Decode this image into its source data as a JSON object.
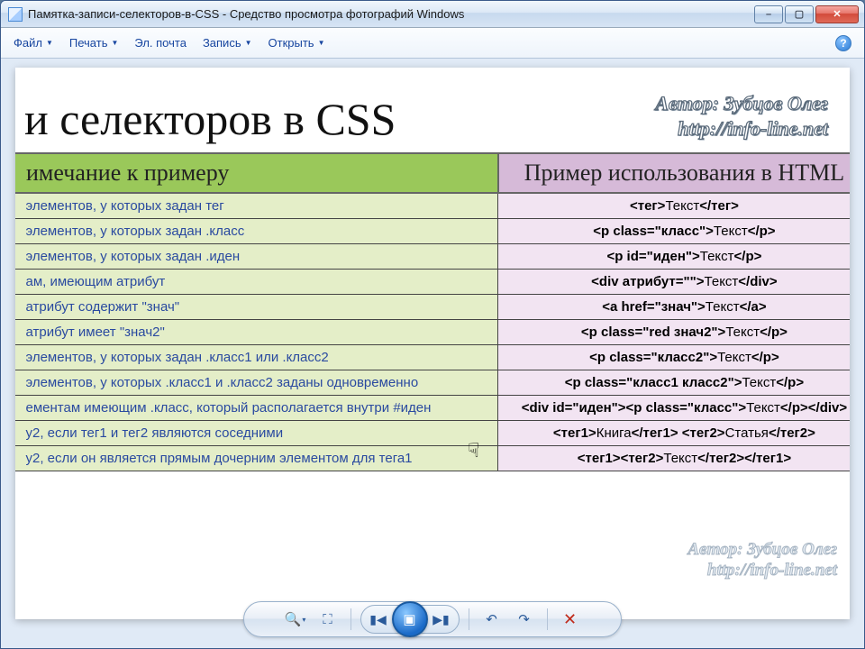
{
  "window": {
    "title": "Памятка-записи-селекторов-в-CSS - Средство просмотра фотографий Windows"
  },
  "menu": {
    "file": "Файл",
    "print": "Печать",
    "email": "Эл. почта",
    "burn": "Запись",
    "open": "Открыть"
  },
  "doc": {
    "title_fragment": "и селекторов в CSS",
    "author_line1": "Автор: Зубцов Олег",
    "author_line2": "http://info-line.net",
    "col_note": "имечание к примеру",
    "col_example": "Пример использования в HTML"
  },
  "rows": [
    {
      "note": "элементов, у которых задан тег",
      "ex": "<тег>Текст</тег>"
    },
    {
      "note": "элементов, у которых задан .класс",
      "ex": "<p class=\"класс\">Текст</p>"
    },
    {
      "note": "элементов, у которых задан .иден",
      "ex": "<p id=\"иден\">Текст</p>"
    },
    {
      "note": "ам, имеющим атрибут",
      "ex": "<div атрибут=\"\">Текст</div>"
    },
    {
      "note": "атрибут содержит \"знач\"",
      "ex": "<a href=\"знач\">Текст</a>"
    },
    {
      "note": "атрибут имеет \"знач2\"",
      "ex": "<p class=\"red знач2\">Текст</p>"
    },
    {
      "note": "элементов, у которых задан .класс1 или .класс2",
      "ex": "<p class=\"класс2\">Текст</p>"
    },
    {
      "note": "элементов, у которых .класс1 и .класс2 заданы одновременно",
      "ex": "<p class=\"класс1 класс2\">Текст</p>"
    },
    {
      "note": "ементам имеющим .класс, который располагается внутри #иден",
      "ex": "<div id=\"иден\"><p class=\"класс\">Текст</p></div>"
    },
    {
      "note": "у2, если тег1 и тег2 являются соседними",
      "ex": "<тег1>Книга</тег1> <тег2>Статья</тег2>"
    },
    {
      "note": "у2, если он является прямым дочерним элементом для тега1",
      "ex": "<тег1><тег2>Текст</тег2></тег1>"
    }
  ]
}
